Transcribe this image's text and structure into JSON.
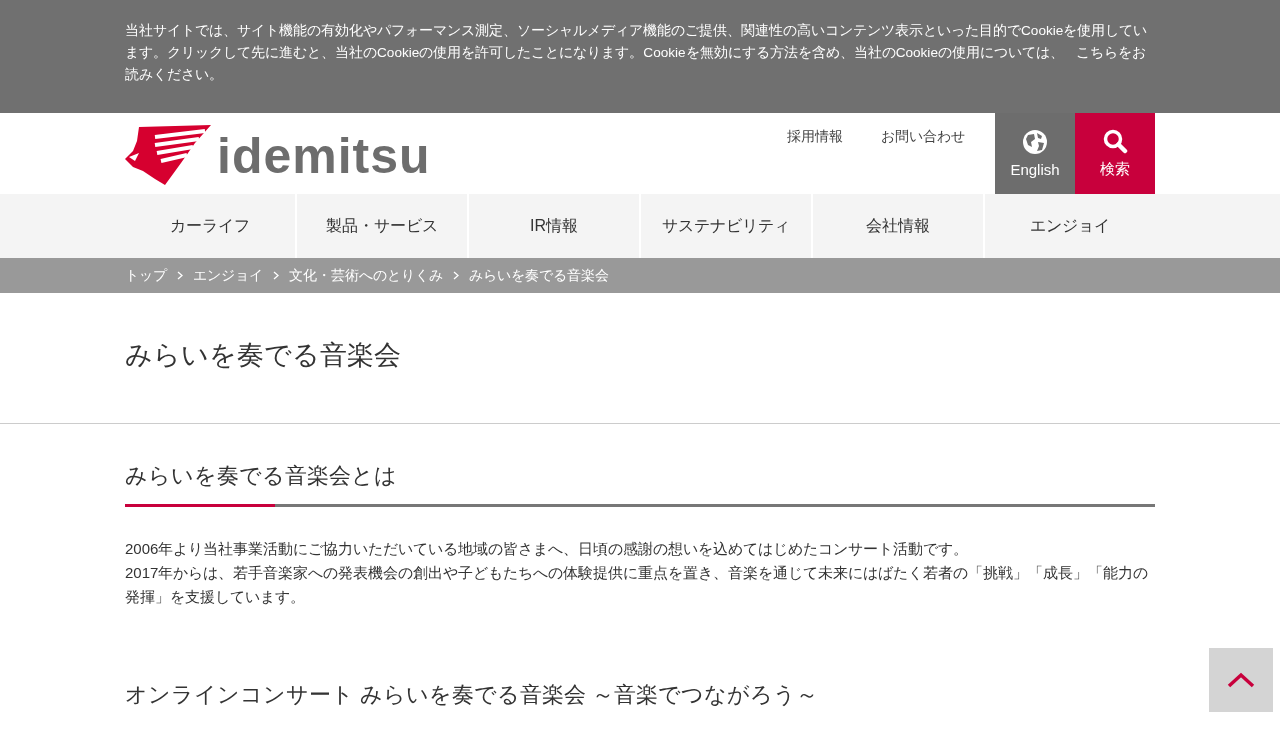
{
  "cookie_notice": {
    "text": "当社サイトでは、サイト機能の有効化やパフォーマンス測定、ソーシャルメディア機能のご提供、関連性の高いコンテンツ表示といった目的でCookieを使用しています。クリックして先に進むと、当社のCookieの使用を許可したことになります。Cookieを無効にする方法を含め、当社のCookieの使用については、 ",
    "link": "こちら",
    "after": "をお読みください。"
  },
  "header": {
    "logo": "idemitsu",
    "links": [
      "採用情報",
      "お問い合わせ"
    ],
    "english": "English",
    "search": "検索"
  },
  "nav": [
    "カーライフ",
    "製品・サービス",
    "IR情報",
    "サステナビリティ",
    "会社情報",
    "エンジョイ"
  ],
  "breadcrumb": [
    "トップ",
    "エンジョイ",
    "文化・芸術へのとりくみ",
    "みらいを奏でる音楽会"
  ],
  "page_title": "みらいを奏でる音楽会",
  "section": {
    "heading": "みらいを奏でる音楽会とは",
    "paragraphs": [
      "2006年より当社事業活動にご協力いただいている地域の皆さまへ、日頃の感謝の想いを込めてはじめたコンサート活動です。",
      "2017年からは、若手音楽家への発表機会の創出や子どもたちへの体験提供に重点を置き、音楽を通じて未来にはばたく若者の「挑戦」「成長」「能力の発揮」を支援しています。"
    ]
  },
  "subheading": "オンラインコンサート みらいを奏でる音楽会 ～音楽でつながろう～"
}
